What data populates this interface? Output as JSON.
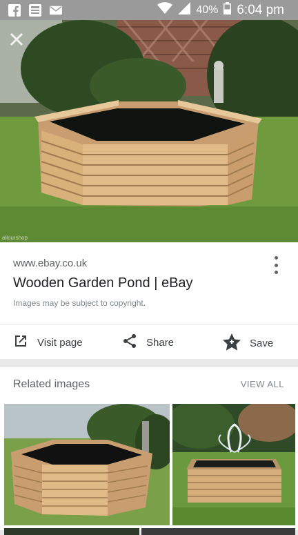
{
  "status_bar": {
    "icons": [
      "facebook-icon",
      "notification-app-icon",
      "mail-icon",
      "wifi-icon",
      "signal-icon",
      "battery-icon"
    ],
    "battery": "40%",
    "time": "6:04 pm"
  },
  "hero": {
    "image": "wooden-garden-pond-photo",
    "watermark": "allourshop",
    "close_icon": "close-icon"
  },
  "result": {
    "site": "www.ebay.co.uk",
    "title": "Wooden Garden Pond | eBay",
    "copyright": "Images may be subject to copyright.",
    "more_icon": "more-vert-icon"
  },
  "actions": {
    "visit": "Visit page",
    "share": "Share",
    "save": "Save"
  },
  "related": {
    "title": "Related images",
    "view_all": "VIEW ALL"
  },
  "colors": {
    "status_bar": "#9a9a9a",
    "card_bg": "#ffffff",
    "text_dark": "#202124",
    "text_muted": "#5f6368"
  }
}
